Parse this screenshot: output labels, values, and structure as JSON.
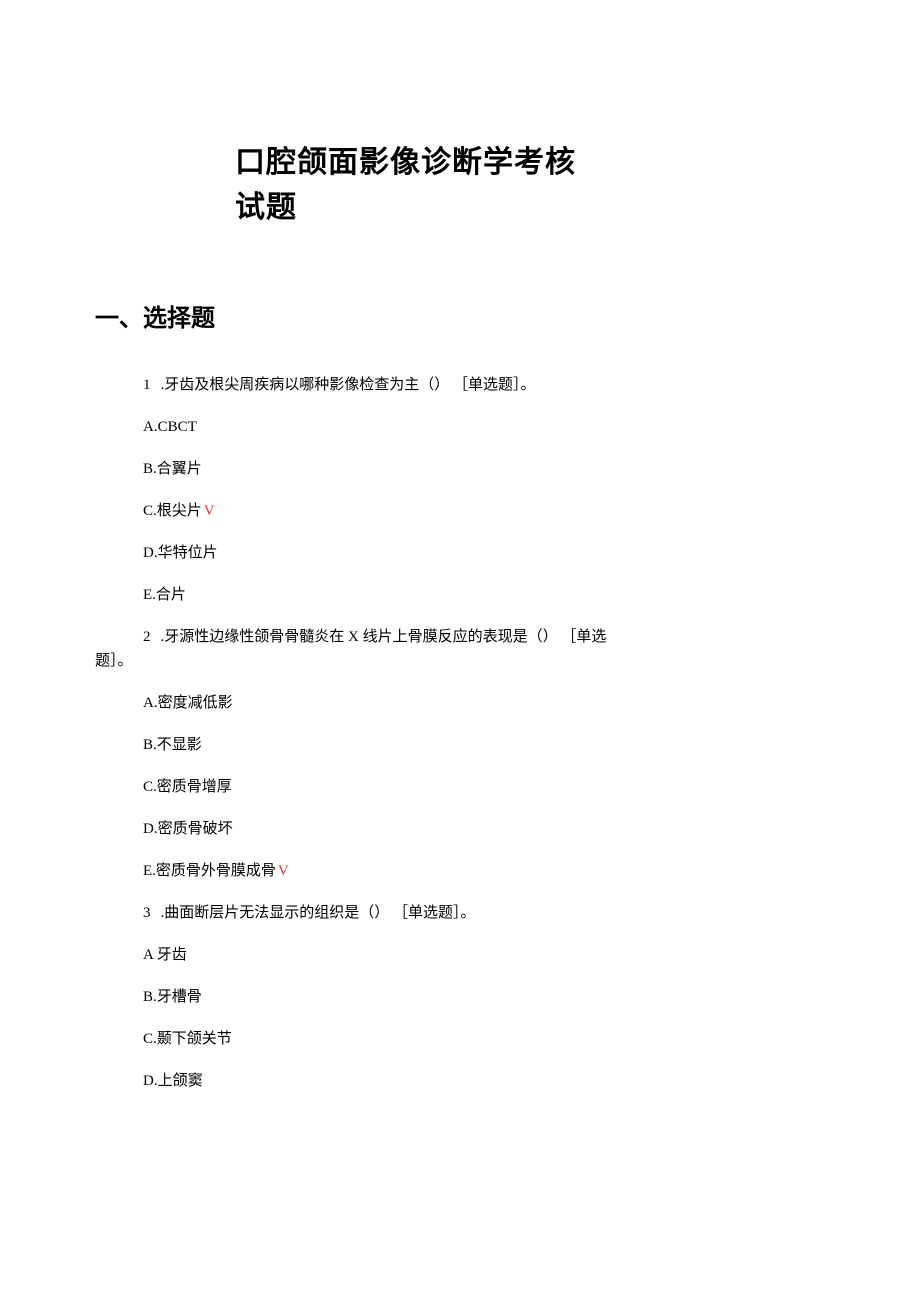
{
  "title": {
    "line1": "口腔颌面影像诊断学考核",
    "line2": "试题"
  },
  "section_heading": "一、选择题",
  "questions": [
    {
      "number": "1",
      "stem": ".牙齿及根尖周疾病以哪种影像检查为主（） ［单选题］。",
      "options": [
        {
          "text": "A.CBCT",
          "correct": false
        },
        {
          "text": "B.合翼片",
          "correct": false
        },
        {
          "text": "C.根尖片",
          "correct": true
        },
        {
          "text": "D.华特位片",
          "correct": false
        },
        {
          "text": "E.合片",
          "correct": false
        }
      ]
    },
    {
      "number": "2",
      "stem_line1": ".牙源性边缘性颌骨骨髓炎在 X 线片上骨膜反应的表现是（） ［单选",
      "stem_line2": "题］。",
      "options": [
        {
          "text": "A.密度减低影",
          "correct": false
        },
        {
          "text": "B.不显影",
          "correct": false
        },
        {
          "text": "C.密质骨增厚",
          "correct": false
        },
        {
          "text": "D.密质骨破坏",
          "correct": false
        },
        {
          "text": "E.密质骨外骨膜成骨",
          "correct": true
        }
      ]
    },
    {
      "number": "3",
      "stem": ".曲面断层片无法显示的组织是（） ［单选题］。",
      "options": [
        {
          "text": "A 牙齿",
          "correct": false
        },
        {
          "text": "B.牙槽骨",
          "correct": false
        },
        {
          "text": "C.颞下颌关节",
          "correct": false
        },
        {
          "text": "D.上颌窦",
          "correct": false
        }
      ]
    }
  ],
  "marker": "V"
}
